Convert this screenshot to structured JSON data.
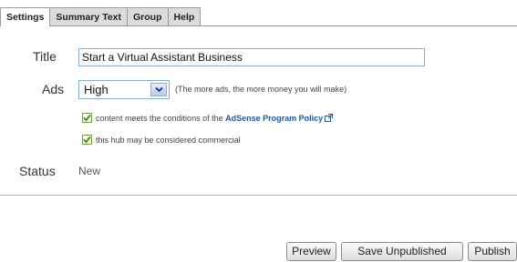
{
  "tabs": [
    {
      "label": "Settings",
      "active": true
    },
    {
      "label": "Summary Text"
    },
    {
      "label": "Group"
    },
    {
      "label": "Help"
    }
  ],
  "form": {
    "title_label": "Title",
    "title_value": "Start a Virtual Assistant Business",
    "ads_label": "Ads",
    "ads_selected": "High",
    "ads_hint": "(The more ads, the more money you will make)",
    "policy_check_prefix": "content meets the conditions of the",
    "policy_link": "AdSense Program Policy",
    "policy_checked": true,
    "commercial_check": "this hub may be considered commercial",
    "commercial_checked": true,
    "status_label": "Status",
    "status_value": "New"
  },
  "buttons": {
    "preview": "Preview",
    "save": "Save Unpublished",
    "publish": "Publish"
  },
  "icons": {
    "dropdown": "chevron-down-icon",
    "external_link": "external-link-icon",
    "check": "checkmark-icon"
  },
  "colors": {
    "link": "#2255aa",
    "input_border": "#7fb0c8",
    "checkmark": "#3a8a1a"
  }
}
